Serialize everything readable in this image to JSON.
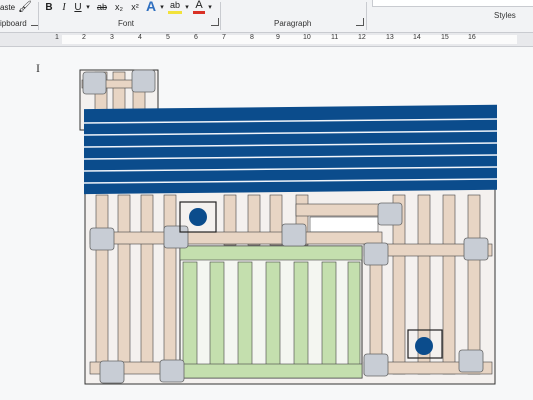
{
  "ribbon": {
    "paste_label": "aste",
    "clipboard_label": "ipboard",
    "font_group_label": "Font",
    "paragraph_group_label": "Paragraph",
    "styles_group_label": "Styles",
    "buttons": {
      "bold": "B",
      "italic": "I",
      "underline": "U",
      "strikethrough": "ab",
      "subscript": "x₂",
      "superscript": "x²",
      "text_effects": "A",
      "highlight": "ab",
      "font_color": "A"
    }
  },
  "ruler": {
    "numbers": [
      "1",
      "2",
      "3",
      "4",
      "5",
      "6",
      "7",
      "8",
      "9",
      "10",
      "11",
      "12",
      "13",
      "14",
      "15",
      "16"
    ]
  },
  "drawing": {
    "colors": {
      "outline": "#333333",
      "peach": "#e8d5c4",
      "green": "#c4dfae",
      "navy": "#0b4c8c",
      "gray_square": "#c8cdd5",
      "dot": "#0b4c8c"
    }
  }
}
